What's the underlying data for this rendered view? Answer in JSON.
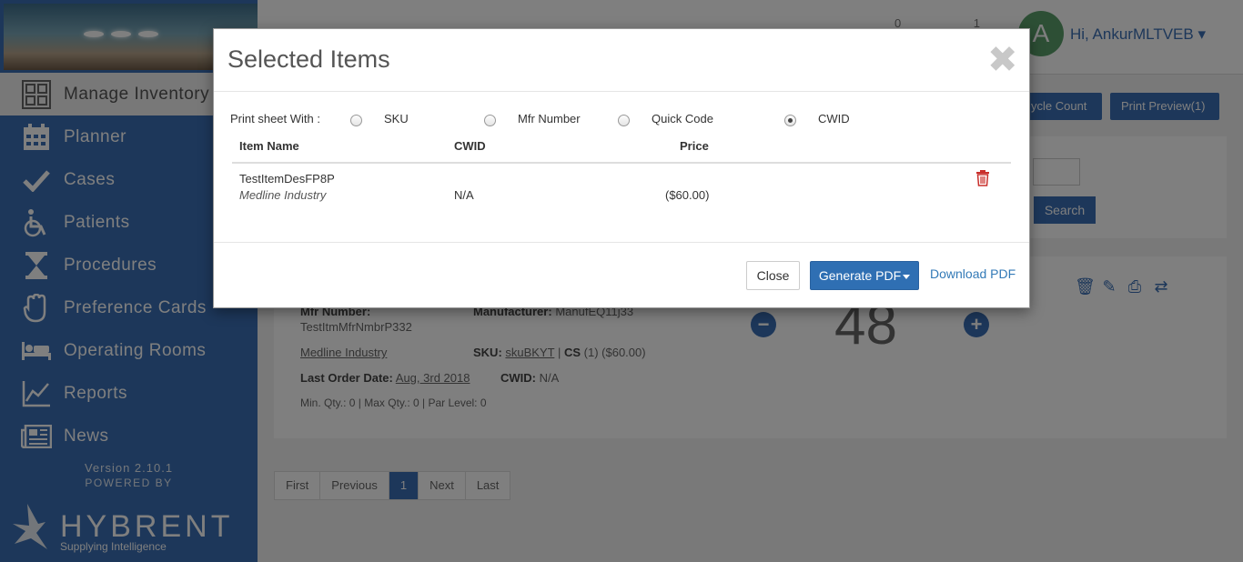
{
  "sidebar": {
    "items": [
      {
        "label": "Manage Inventory",
        "icon": "inventory-grid-icon"
      },
      {
        "label": "Planner",
        "icon": "calendar-icon"
      },
      {
        "label": "Cases",
        "icon": "checkmark-icon"
      },
      {
        "label": "Patients",
        "icon": "wheelchair-icon"
      },
      {
        "label": "Procedures",
        "icon": "hourglass-icon"
      },
      {
        "label": "Preference Cards",
        "icon": "glove-icon"
      },
      {
        "label": "Operating Rooms",
        "icon": "bed-icon"
      },
      {
        "label": "Reports",
        "icon": "line-chart-icon"
      },
      {
        "label": "News",
        "icon": "newspaper-icon"
      }
    ],
    "version": "Version 2.10.1",
    "powered_by": "POWERED BY",
    "brand_name": "HYBRENT",
    "brand_tagline": "Supplying Intelligence"
  },
  "header": {
    "avatar_letter": "A",
    "greeting": "Hi, AnkurMLTVEB",
    "counter_a": "0",
    "counter_b": "1"
  },
  "toolbar": {
    "cycle_count_label": "ycle Count",
    "print_preview_label": "Print Preview(1)",
    "search_label": "Search"
  },
  "item_card": {
    "mfr_number_label": "Mfr Number:",
    "mfr_number_value": "TestItmMfrNmbrP332",
    "manufacturer_label": "Manufacturer:",
    "manufacturer_value": "ManufEQ11j33",
    "vendor": "Medline Industry",
    "sku_label": "SKU:",
    "sku_value": "skuBKYT",
    "uom_label": "CS",
    "uom_detail": "(1) ($60.00)",
    "last_order_label": "Last Order Date:",
    "last_order_value": "Aug, 3rd 2018",
    "cwid_label": "CWID:",
    "cwid_value": "N/A",
    "levels": "Min. Qty.: 0 | Max Qty.: 0 | Par Level: 0",
    "quantity": "48"
  },
  "pagination": {
    "first": "First",
    "previous": "Previous",
    "current": "1",
    "next": "Next",
    "last": "Last"
  },
  "modal": {
    "title": "Selected Items",
    "print_with_label": "Print sheet With :",
    "options": [
      {
        "label": "SKU",
        "checked": false
      },
      {
        "label": "Mfr Number",
        "checked": false
      },
      {
        "label": "Quick Code",
        "checked": false
      },
      {
        "label": "CWID",
        "checked": true
      }
    ],
    "columns": {
      "item_name": "Item Name",
      "cwid": "CWID",
      "price": "Price"
    },
    "rows": [
      {
        "item_name": "TestItemDesFP8P",
        "vendor": "Medline Industry",
        "cwid": "N/A",
        "price": "($60.00)"
      }
    ],
    "close_label": "Close",
    "generate_label": "Generate PDF",
    "download_label": "Download PDF"
  },
  "colors": {
    "sidebar": "#3a6fb4",
    "primary_button": "#2f6fb3",
    "link": "#337ab7",
    "delete": "#c9302c"
  }
}
